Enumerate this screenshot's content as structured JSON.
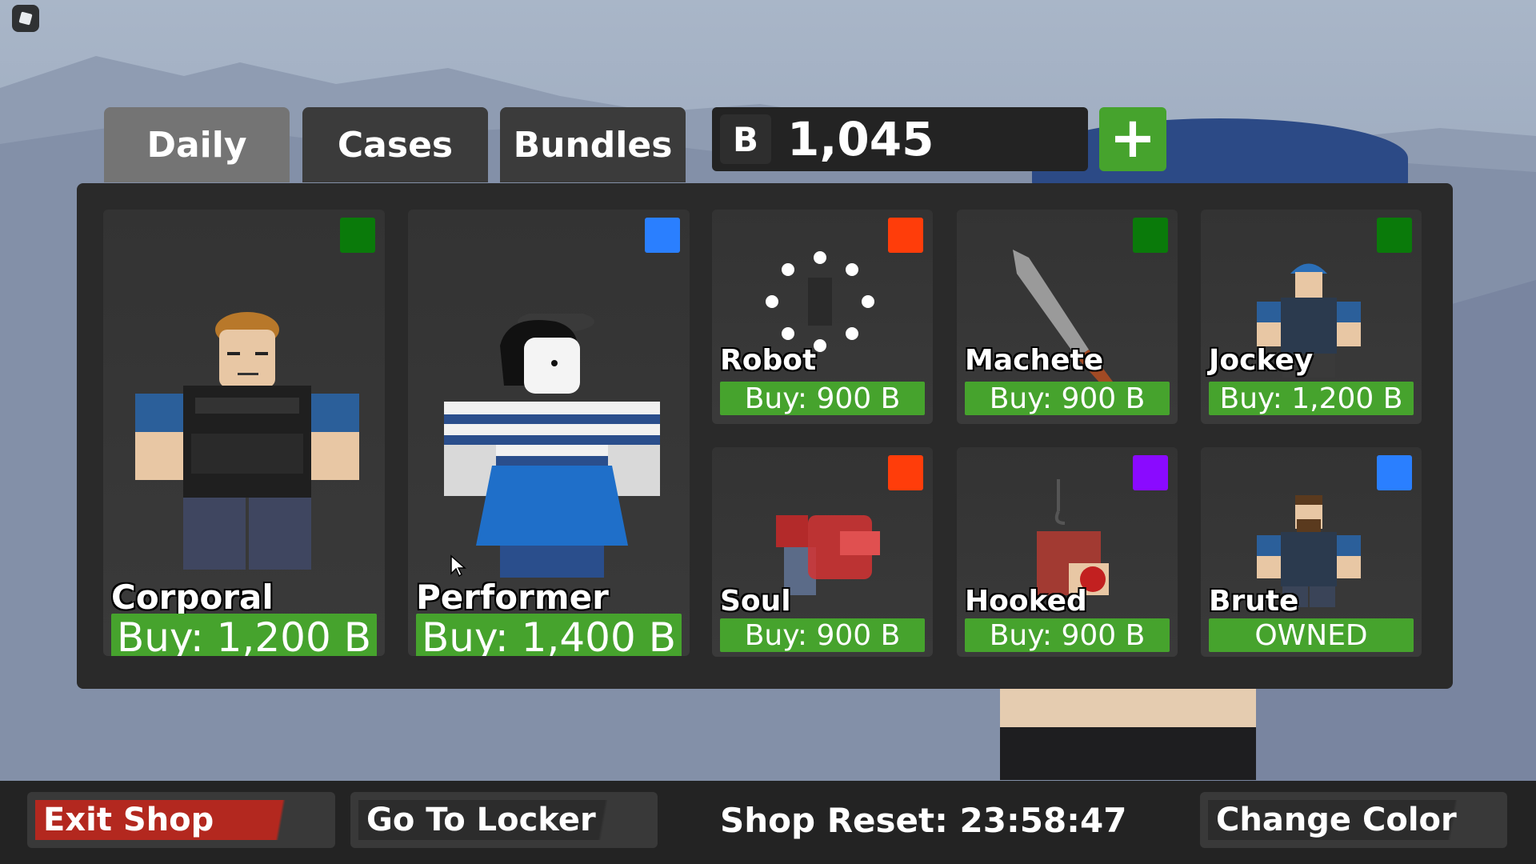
{
  "tabs": [
    {
      "label": "Daily",
      "active": true
    },
    {
      "label": "Cases",
      "active": false
    },
    {
      "label": "Bundles",
      "active": false
    }
  ],
  "currency": {
    "symbol": "B",
    "amount": "1,045",
    "add_icon": "plus-icon"
  },
  "items": [
    {
      "name": "Corporal",
      "price": "Buy: 1,200 B",
      "rarity_color": "#0a7a0a"
    },
    {
      "name": "Performer",
      "price": "Buy: 1,400 B",
      "rarity_color": "#2a7fff"
    },
    {
      "name": "Robot",
      "price": "Buy: 900 B",
      "rarity_color": "#ff3d0a"
    },
    {
      "name": "Machete",
      "price": "Buy: 900 B",
      "rarity_color": "#0a7a0a"
    },
    {
      "name": "Jockey",
      "price": "Buy: 1,200 B",
      "rarity_color": "#0a7a0a"
    },
    {
      "name": "Soul",
      "price": "Buy: 900 B",
      "rarity_color": "#ff3d0a"
    },
    {
      "name": "Hooked",
      "price": "Buy: 900 B",
      "rarity_color": "#8a0aff"
    },
    {
      "name": "Brute",
      "price": "OWNED",
      "rarity_color": "#2a7fff"
    }
  ],
  "bottom": {
    "exit_label": "Exit Shop",
    "locker_label": "Go To Locker",
    "reset_text": "Shop Reset: 23:58:47",
    "color_label": "Change Color"
  },
  "colors": {
    "buy_green": "#46a32d",
    "exit_red": "#b3281f"
  }
}
